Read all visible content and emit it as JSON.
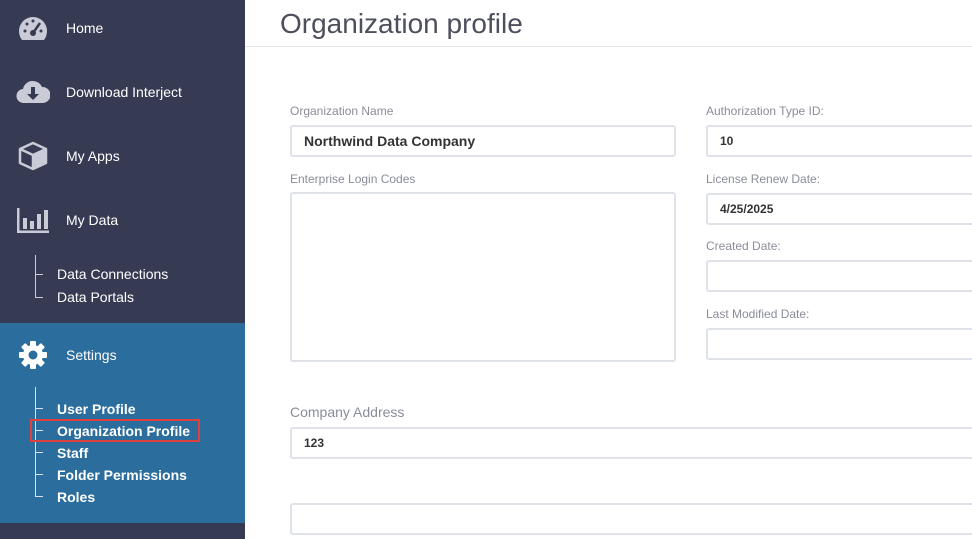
{
  "sidebar": {
    "nav": {
      "home": "Home",
      "download": "Download Interject",
      "apps": "My Apps",
      "data": "My Data",
      "settings": "Settings"
    },
    "data_sub": [
      "Data Connections",
      "Data Portals"
    ],
    "settings_sub": [
      "User Profile",
      "Organization Profile",
      "Staff",
      "Folder Permissions",
      "Roles"
    ],
    "icons": {
      "home": "dashboard-gauge-icon",
      "download": "cloud-download-icon",
      "apps": "cube-icon",
      "data": "bar-chart-icon",
      "settings": "gear-icon"
    },
    "colors": {
      "background": "#363a52",
      "settings_background": "#2b6e9e",
      "active_highlight": "#e0413f"
    }
  },
  "main": {
    "title": "Organization profile",
    "org_name": {
      "label": "Organization Name",
      "value": "Northwind Data Company"
    },
    "enterprise_codes": {
      "label": "Enterprise Login Codes",
      "value": ""
    },
    "auth_type": {
      "label": "Authorization Type ID:",
      "value": "10"
    },
    "license_renew": {
      "label": "License Renew Date:",
      "value": "4/25/2025"
    },
    "created": {
      "label": "Created Date:",
      "value": ""
    },
    "modified": {
      "label": "Last Modified Date:",
      "value": ""
    },
    "company_address": {
      "label": "Company Address",
      "line1": "123",
      "line2": ""
    }
  }
}
